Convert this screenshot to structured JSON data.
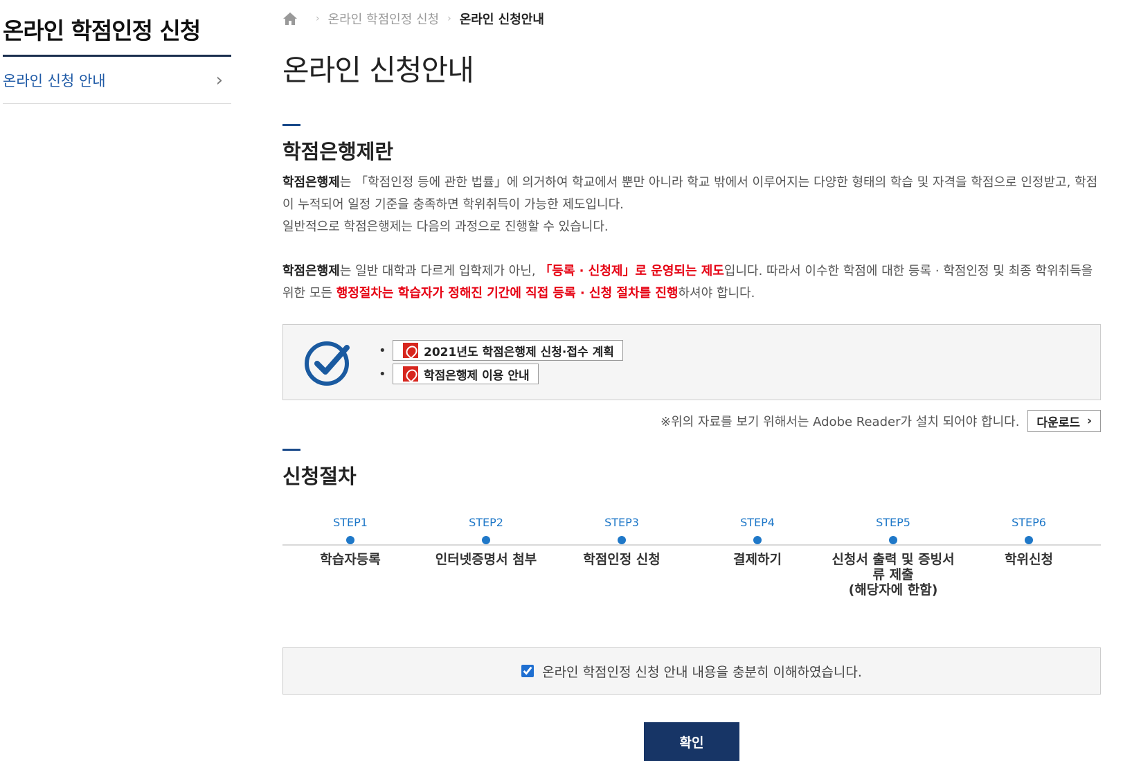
{
  "sidebar": {
    "title": "온라인 학점인정 신청",
    "items": [
      {
        "label": "온라인 신청 안내"
      }
    ]
  },
  "breadcrumb": {
    "items": [
      "온라인 학점인정 신청",
      "온라인 신청안내"
    ]
  },
  "page_title": "온라인 신청안내",
  "section1": {
    "title": "학점은행제란",
    "p1_bold": "학점은행제",
    "p1_text": "는 「학점인정 등에 관한 법률」에 의거하여 학교에서 뿐만 아니라 학교 밖에서 이루어지는 다양한 형태의 학습 및 자격을 학점으로 인정받고, 학점이 누적되어 일정 기준을 충족하면 학위취득이 가능한 제도입니다.",
    "p1_line2": "일반적으로 학점은행제는 다음의 과정으로 진행할 수 있습니다.",
    "p2_bold": "학점은행제",
    "p2_a": "는 일반 대학과 다르게 입학제가 아닌, ",
    "p2_red1": "「등록 · 신청제」로 운영되는 제도",
    "p2_b": "입니다. 따라서 이수한 학점에 대한 등록 · 학점인정 및 최종 학위취득을 위한 모든 ",
    "p2_red2": "행정절차는 학습자가 정해진 기간에 직접 등록 · 신청 절차를 진행",
    "p2_c": "하셔야 합니다."
  },
  "docs": {
    "items": [
      {
        "label": "2021년도 학점은행제 신청·접수 계획"
      },
      {
        "label": "학점은행제 이용 안내"
      }
    ],
    "note": "※위의 자료를 보기 위해서는 Adobe Reader가 설치 되어야 합니다.",
    "download_label": "다운로드",
    "download_arrow": "›"
  },
  "section2": {
    "title": "신청절차",
    "steps": [
      {
        "label": "STEP1",
        "name": "학습자등록"
      },
      {
        "label": "STEP2",
        "name": "인터넷증명서 첨부"
      },
      {
        "label": "STEP3",
        "name": "학점인정 신청"
      },
      {
        "label": "STEP4",
        "name": "결제하기"
      },
      {
        "label": "STEP5",
        "name": "신청서 출력 및 증빙서\n류 제출\n(해당자에 한함)"
      },
      {
        "label": "STEP6",
        "name": "학위신청"
      }
    ]
  },
  "agree": {
    "label": "온라인 학점인정 신청 안내 내용을 충분히 이해하였습니다.",
    "checked": true
  },
  "confirm_label": "확인",
  "colors": {
    "accent": "#1f78c8",
    "navy": "#173566",
    "red": "#e60012"
  }
}
